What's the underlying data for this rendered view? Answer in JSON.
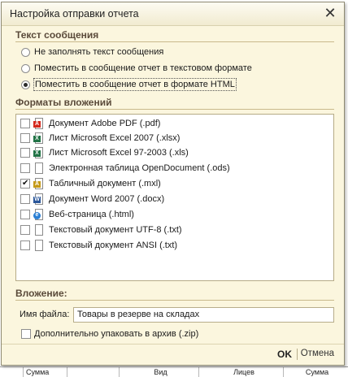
{
  "dialog": {
    "title": "Настройка отправки отчета",
    "close_glyph": "✕"
  },
  "message_section": {
    "heading": "Текст сообщения",
    "options": [
      {
        "label": "Не заполнять текст сообщения",
        "selected": false
      },
      {
        "label": "Поместить в сообщение отчет в текстовом формате",
        "selected": false
      },
      {
        "label": "Поместить в сообщение отчет в формате HTML",
        "selected": true
      }
    ]
  },
  "formats_section": {
    "heading": "Форматы вложений",
    "items": [
      {
        "label": "Документ Adobe PDF (.pdf)",
        "checked": false,
        "icon": "pdf-icon",
        "color": "#d42a1e"
      },
      {
        "label": "Лист Microsoft Excel 2007 (.xlsx)",
        "checked": false,
        "icon": "excel-icon",
        "color": "#217346"
      },
      {
        "label": "Лист Microsoft Excel 97-2003 (.xls)",
        "checked": false,
        "icon": "excel-icon",
        "color": "#217346"
      },
      {
        "label": "Электронная таблица OpenDocument (.ods)",
        "checked": false,
        "icon": "document-icon",
        "color": "#8a8a8a"
      },
      {
        "label": "Табличный документ (.mxl)",
        "checked": true,
        "icon": "spreadsheet-icon",
        "color": "#c59a1a"
      },
      {
        "label": "Документ Word 2007 (.docx)",
        "checked": false,
        "icon": "word-icon",
        "color": "#2b579a"
      },
      {
        "label": "Веб-страница (.html)",
        "checked": false,
        "icon": "web-icon",
        "color": "#2a7fd4"
      },
      {
        "label": "Текстовый документ UTF-8 (.txt)",
        "checked": false,
        "icon": "text-file-icon",
        "color": "#8a8a8a"
      },
      {
        "label": "Текстовый документ ANSI (.txt)",
        "checked": false,
        "icon": "text-file-icon",
        "color": "#8a8a8a"
      }
    ]
  },
  "attachment_section": {
    "heading": "Вложение:",
    "filename_label": "Имя файла:",
    "filename_value": "Товары в резерве на складах",
    "zip_label": "Дополнительно упаковать в архив (.zip)",
    "zip_checked": false
  },
  "buttons": {
    "ok": "OK",
    "cancel": "Отмена"
  },
  "background_table": {
    "columns": [
      "",
      "Сумма",
      "Вид",
      "Лицев",
      "Сумма"
    ]
  }
}
